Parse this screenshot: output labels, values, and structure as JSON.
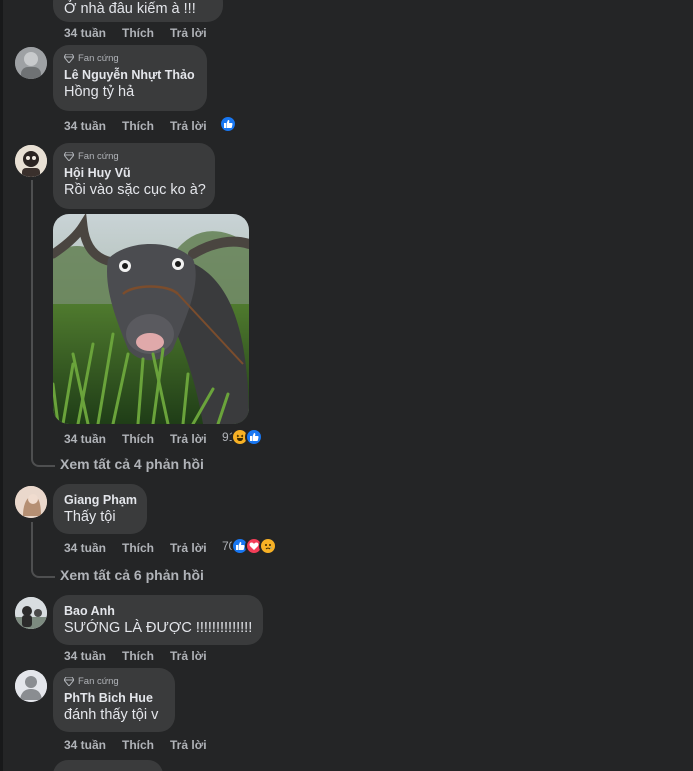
{
  "colors": {
    "background": "#18191a",
    "panel": "#242526",
    "bubble": "#3a3b3c",
    "text_primary": "#e4e6eb",
    "text_secondary": "#b0b3b8",
    "like_blue": "#1877f2",
    "love_red": "#f33e58",
    "haha_yellow": "#f7b125"
  },
  "comments": [
    {
      "author": "",
      "text": "Ở nhà đâu kiếm à !!!",
      "actions": {
        "time": "34 tuần",
        "like": "Thích",
        "reply": "Trả lời"
      }
    },
    {
      "badge": "Fan cứng",
      "author": "Lê Nguyễn Nhựt Thảo",
      "text": "Hồng tỷ hả",
      "actions": {
        "time": "34 tuần",
        "like": "Thích",
        "reply": "Trả lời"
      },
      "reactions": [
        "like"
      ]
    },
    {
      "badge": "Fan cứng",
      "author": "Hội Huy Vũ",
      "text": "Rồi vào sặc cục ko à?",
      "image": "water-buffalo-eating-grass-photo",
      "actions": {
        "time": "34 tuần",
        "like": "Thích",
        "reply": "Trả lời"
      },
      "reaction_count": "91",
      "reactions": [
        "haha",
        "like"
      ],
      "view_replies": "Xem tất cả 4 phản hồi"
    },
    {
      "author": "Giang Phạm",
      "text": "Thấy tội",
      "actions": {
        "time": "34 tuần",
        "like": "Thích",
        "reply": "Trả lời"
      },
      "reaction_count": "70",
      "reactions": [
        "like",
        "love",
        "sad"
      ],
      "view_replies": "Xem tất cả 6 phản hồi"
    },
    {
      "author": "Bao Anh",
      "text": "SƯỚNG LÀ ĐƯỢC !!!!!!!!!!!!!!",
      "actions": {
        "time": "34 tuần",
        "like": "Thích",
        "reply": "Trả lời"
      }
    },
    {
      "badge": "Fan cứng",
      "author": "PhTh Bich Hue",
      "text": "đánh thấy tội v",
      "actions": {
        "time": "34 tuần",
        "like": "Thích",
        "reply": "Trả lời"
      }
    }
  ]
}
